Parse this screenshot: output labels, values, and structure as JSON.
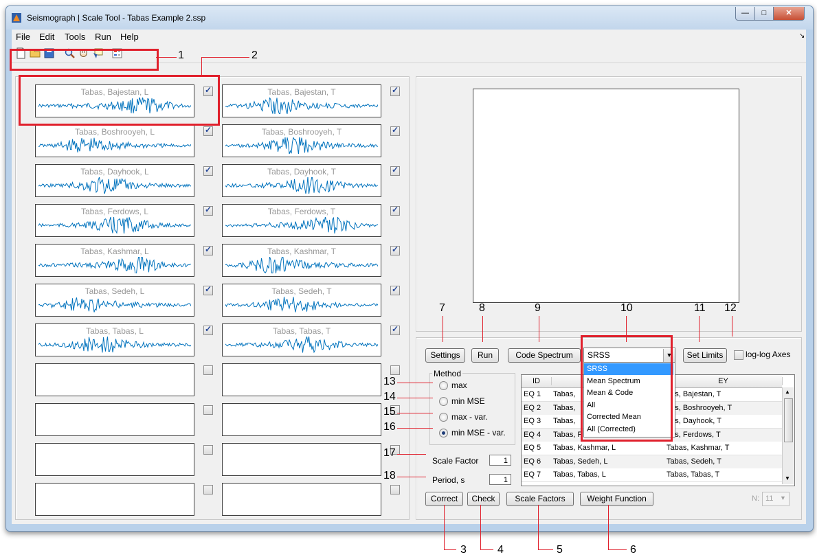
{
  "window": {
    "title": "Seismograph | Scale Tool - Tabas Example 2.ssp"
  },
  "menu": [
    "File",
    "Edit",
    "Tools",
    "Run",
    "Help"
  ],
  "toolbar_icons": [
    "new-file-icon",
    "open-folder-icon",
    "save-icon",
    "zoom-icon",
    "pan-hand-icon",
    "data-cursor-icon",
    "legend-icon"
  ],
  "signals_left": [
    "Tabas, Bajestan, L",
    "Tabas, Boshrooyeh, L",
    "Tabas, Dayhook, L",
    "Tabas, Ferdows, L",
    "Tabas, Kashmar, L",
    "Tabas, Sedeh, L",
    "Tabas, Tabas, L",
    "",
    "",
    "",
    ""
  ],
  "signals_right": [
    "Tabas, Bajestan, T",
    "Tabas, Boshrooyeh, T",
    "Tabas, Dayhook, T",
    "Tabas, Ferdows, T",
    "Tabas, Kashmar, T",
    "Tabas, Sedeh, T",
    "Tabas, Tabas, T",
    "",
    "",
    "",
    ""
  ],
  "signals_checked": [
    true,
    true,
    true,
    true,
    true,
    true,
    true,
    false,
    false,
    false,
    false
  ],
  "buttons": {
    "settings": "Settings",
    "run": "Run",
    "code_spectrum": "Code Spectrum",
    "set_limits": "Set Limits",
    "correct": "Correct",
    "check": "Check",
    "scale_factors": "Scale Factors",
    "weight_function": "Weight Function"
  },
  "loglog_label": "log-log Axes",
  "spectrum_select": {
    "value": "SRSS",
    "options": [
      "SRSS",
      "Mean Spectrum",
      "Mean & Code",
      "All",
      "Corrected Mean",
      "All (Corrected)"
    ]
  },
  "method": {
    "title": "Method",
    "options": [
      "max",
      "min MSE",
      "max - var.",
      "min MSE - var."
    ],
    "selected": 3
  },
  "scale_factor": {
    "label": "Scale Factor",
    "value": "1"
  },
  "period": {
    "label": "Period, s",
    "value": "1"
  },
  "table": {
    "headers": [
      "ID",
      "",
      "EY"
    ],
    "rows": [
      [
        "EQ 1",
        "Tabas,",
        "bas, Bajestan, T"
      ],
      [
        "EQ 2",
        "Tabas,",
        "bas, Boshrooyeh, T"
      ],
      [
        "EQ 3",
        "Tabas,",
        "bas, Dayhook, T"
      ],
      [
        "EQ 4",
        "Tabas, F",
        "bas, Ferdows, T"
      ],
      [
        "EQ 5",
        "Tabas, Kashmar, L",
        "Tabas, Kashmar, T"
      ],
      [
        "EQ 6",
        "Tabas, Sedeh, L",
        "Tabas, Sedeh, T"
      ],
      [
        "EQ 7",
        "Tabas, Tabas, L",
        "Tabas, Tabas, T"
      ]
    ]
  },
  "n_select": {
    "label": "N:",
    "value": "11"
  },
  "callouts": [
    "1",
    "2",
    "3",
    "4",
    "5",
    "6",
    "7",
    "8",
    "9",
    "10",
    "11",
    "12",
    "13",
    "14",
    "15",
    "16",
    "17",
    "18"
  ],
  "colors": {
    "accent_red": "#e0202c",
    "wave_blue": "#0072bd",
    "select_blue": "#3399ff"
  }
}
